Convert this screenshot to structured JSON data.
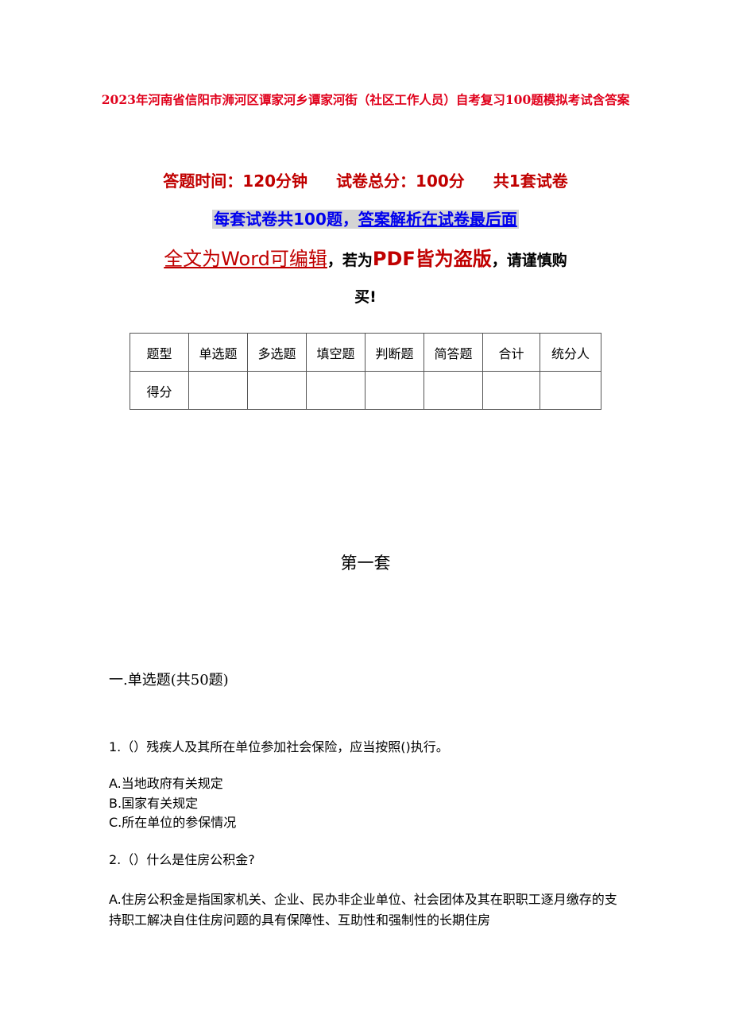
{
  "document": {
    "title": "2023年河南省信阳市浉河区谭家河乡谭家河街（社区工作人员）自考复习100题模拟考试含答案",
    "meta": {
      "time": "答题时间：120分钟",
      "total": "试卷总分：100分",
      "sets": "共1套试卷"
    },
    "notice": {
      "part1": "每套试卷共100题，",
      "part2": "答案解析在试卷最后面"
    },
    "edit_notice": {
      "part1": "全文为Word可编辑",
      "comma1": "，若为",
      "part2": "PDF皆为盗版",
      "part3": "，请谨慎购",
      "part4": "买!"
    },
    "score_table": {
      "header": [
        "题型",
        "单选题",
        "多选题",
        "填空题",
        "判断题",
        "简答题",
        "合计",
        "统分人"
      ],
      "row": [
        "得分",
        "",
        "",
        "",
        "",
        "",
        "",
        ""
      ]
    },
    "set_title": "第一套",
    "section_title": "一.单选题(共50题)",
    "questions": [
      {
        "text": "1.（）残疾人及其所在单位参加社会保险，应当按照()执行。",
        "options": [
          "A.当地政府有关规定",
          "B.国家有关规定",
          "C.所在单位的参保情况"
        ]
      },
      {
        "text": "2.（）什么是住房公积金?",
        "options": [
          "A.住房公积金是指国家机关、企业、民办非企业单位、社会团体及其在职职工逐月缴存的支持职工解决自住住房问题的具有保障性、互助性和强制性的长期住房"
        ]
      }
    ]
  }
}
